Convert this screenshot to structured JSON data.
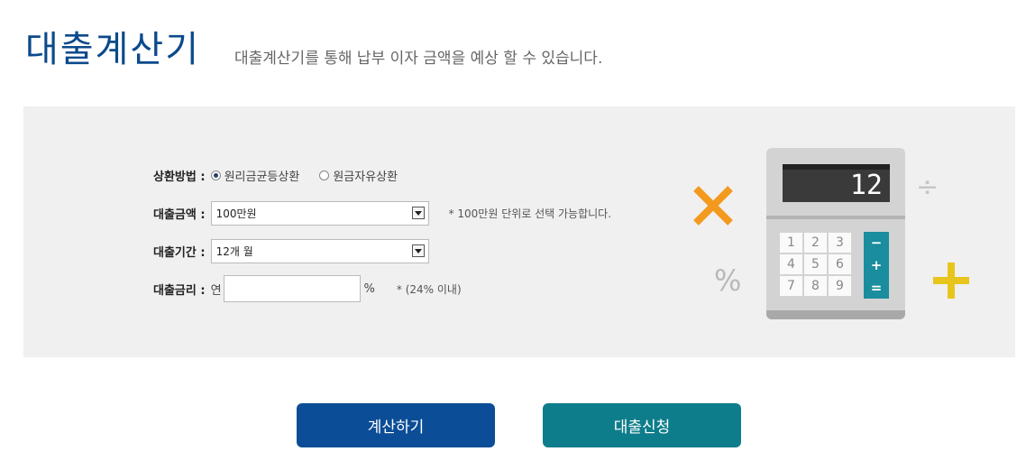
{
  "header": {
    "title": "대출계산기",
    "subtitle": "대출계산기를 통해 납부 이자 금액을 예상 할 수 있습니다."
  },
  "form": {
    "repayment": {
      "label": "상환방법 :",
      "options": [
        "원리금균등상환",
        "원금자유상환"
      ],
      "selected": "원리금균등상환"
    },
    "amount": {
      "label": "대출금액 :",
      "value": "100만원",
      "hint": "* 100만원 단위로 선택 가능합니다."
    },
    "term": {
      "label": "대출기간 :",
      "value": "12개 월"
    },
    "rate": {
      "label": "대출금리 :",
      "prefix": "연",
      "value": "",
      "unit": "%",
      "hint": "* (24% 이내)"
    }
  },
  "buttons": {
    "calculate": "계산하기",
    "apply": "대출신청"
  },
  "illustration": {
    "display": "12",
    "keys": [
      "1",
      "2",
      "3",
      "4",
      "5",
      "6",
      "7",
      "8",
      "9"
    ],
    "operators": [
      "−",
      "+",
      "="
    ],
    "percent_symbol": "%",
    "divide_symbol": "÷",
    "colors": {
      "times": "#f39a1e",
      "plus": "#e8c51c",
      "operator_column": "#1a8d9e"
    }
  },
  "colors": {
    "primary_button": "#0b4d96",
    "secondary_button": "#0e7d8b",
    "title": "#0b4a8b"
  }
}
